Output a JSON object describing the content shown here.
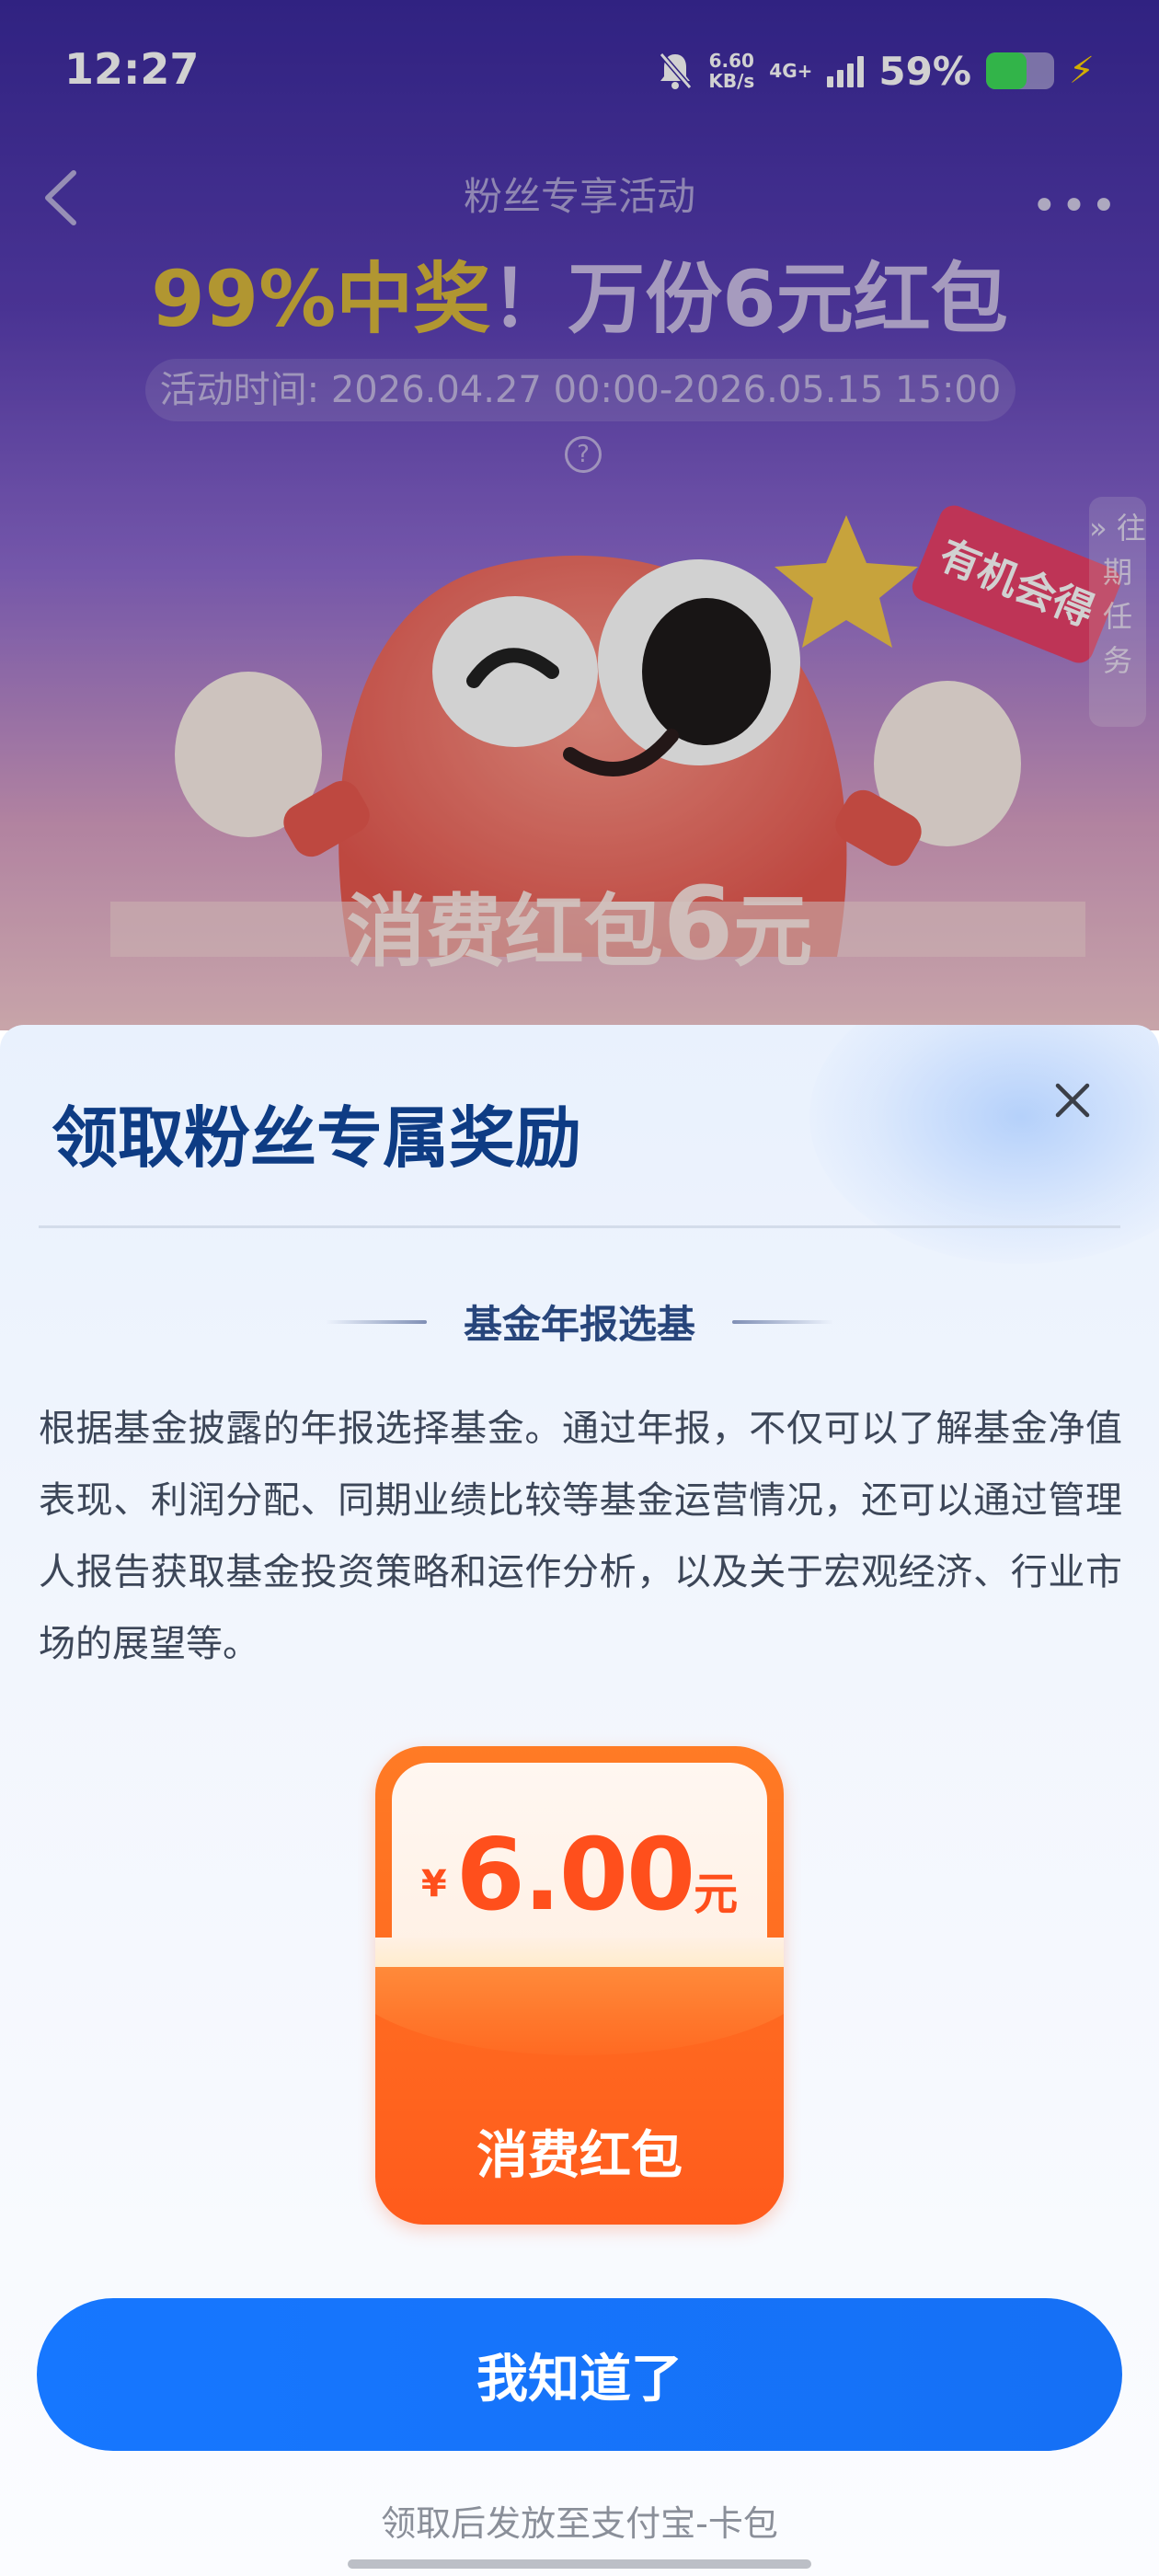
{
  "status_bar": {
    "time": "12:27",
    "net_speed_value": "6.60",
    "net_speed_unit": "KB/s",
    "net_type": "4G+",
    "battery_percent": "59%",
    "battery_level": 0.59,
    "battery_color": "#3ddc5a"
  },
  "activity_page": {
    "nav_title": "粉丝专享活动",
    "headline_highlight": "99%中奖",
    "headline_rest": "！万份6元红包",
    "period": "活动时间: 2026.04.27 00:00-2026.05.15 15:00",
    "period_help_icon": "?",
    "tag_label": "有机会得",
    "side_tab_label": "» 往期任务",
    "coupon_caption_prefix": "消费红包",
    "coupon_caption_amount": "6",
    "coupon_caption_unit": "元",
    "background_gradient_top": "#3b2a9e"
  },
  "sheet": {
    "title": "领取粉丝专属奖励",
    "section_title": "基金年报选基",
    "description": "根据基金披露的年报选择基金。通过年报，不仅可以了解基金净值表现、利润分配、同期业绩比较等基金运营情况，还可以通过管理人报告获取基金投资策略和运作分析，以及关于宏观经济、行业市场的展望等。",
    "packet": {
      "currency": "¥",
      "amount": "6.00",
      "unit": "元",
      "label": "消费红包",
      "color": "#ff5b1c"
    },
    "confirm_button": "我知道了",
    "confirm_color": "#1677ff",
    "footnote": "领取后发放至支付宝-卡包"
  }
}
